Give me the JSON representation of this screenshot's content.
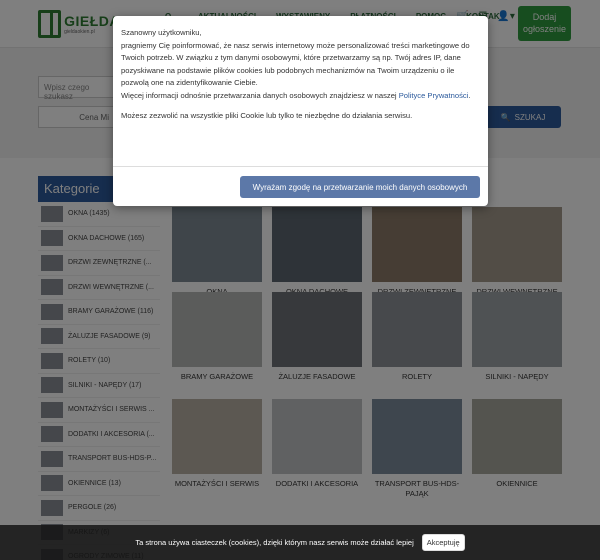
{
  "header": {
    "logo_title": "GIEŁDA",
    "logo_sub": "gieldaokien.pl",
    "nav": [
      "O...",
      "AKTUALNOŚCI",
      "WYSTAWIENY",
      "PŁATNOŚCI",
      "POMOC",
      "KONTAKT"
    ],
    "add_button": "Dodaj ogłoszenie"
  },
  "search": {
    "placeholder": "Wpisz czego szukasz",
    "price_label": "Cena Mi",
    "button": "SZUKAJ"
  },
  "sidebar": {
    "title": "Kategorie",
    "items": [
      "OKNA (1435)",
      "OKNA DACHOWE (165)",
      "DRZWI ZEWNĘTRZNE (...",
      "DRZWI WEWNĘTRZNE (...",
      "BRAMY GARAŻOWE (116)",
      "ŻALUZJE FASADOWE (9)",
      "ROLETY (10)",
      "SILNIKI - NAPĘDY (17)",
      "MONTAŻYŚCI I SERWIS ...",
      "DODATKI I AKCESORIA (...",
      "TRANSPORT BUS-HDS-P...",
      "OKIENNICE (13)",
      "PERGOLE (26)",
      "MARKIZY (6)",
      "OGRODY ZIMOWE (11)"
    ]
  },
  "tiles": [
    "OKNA",
    "OKNA DACHOWE",
    "DRZWI ZEWNĘTRZNE",
    "DRZWI WEWNĘTRZNE",
    "BRAMY GARAŻOWE",
    "ŻALUZJE FASADOWE",
    "ROLETY",
    "SILNIKI - NAPĘDY",
    "MONTAŻYŚCI I SERWIS",
    "DODATKI I AKCESORIA",
    "TRANSPORT BUS-HDS-PAJĄK",
    "OKIENNICE"
  ],
  "modal": {
    "greeting": "Szanowny użytkowniku,",
    "text1": "pragniemy Cię poinformować, że nasz serwis internetowy może personalizować treści marketingowe do Twoich potrzeb. W związku z tym danymi osobowymi, które przetwarzamy są np. Twój adres IP, dane pozyskiwane na podstawie plików cookies lub podobnych mechanizmów na Twoim urządzeniu o ile pozwolą one na zidentyfikowanie Ciebie.",
    "text2_prefix": "Więcej informacji odnośnie przetwarzania danych osobowych znajdziesz w naszej ",
    "text2_link": "Polityce Prywatności",
    "text2_suffix": ".",
    "text3": "Możesz zezwolić na wszystkie pliki Cookie lub tylko te niezbędne do działania serwisu.",
    "accept_button": "Wyrażam zgodę na przetwarzanie moich danych osobowych"
  },
  "cookie_bar": {
    "text": "Ta strona używa ciasteczek (cookies), dzięki którym nasz serwis może działać lepiej",
    "button": "Akceptuję"
  }
}
